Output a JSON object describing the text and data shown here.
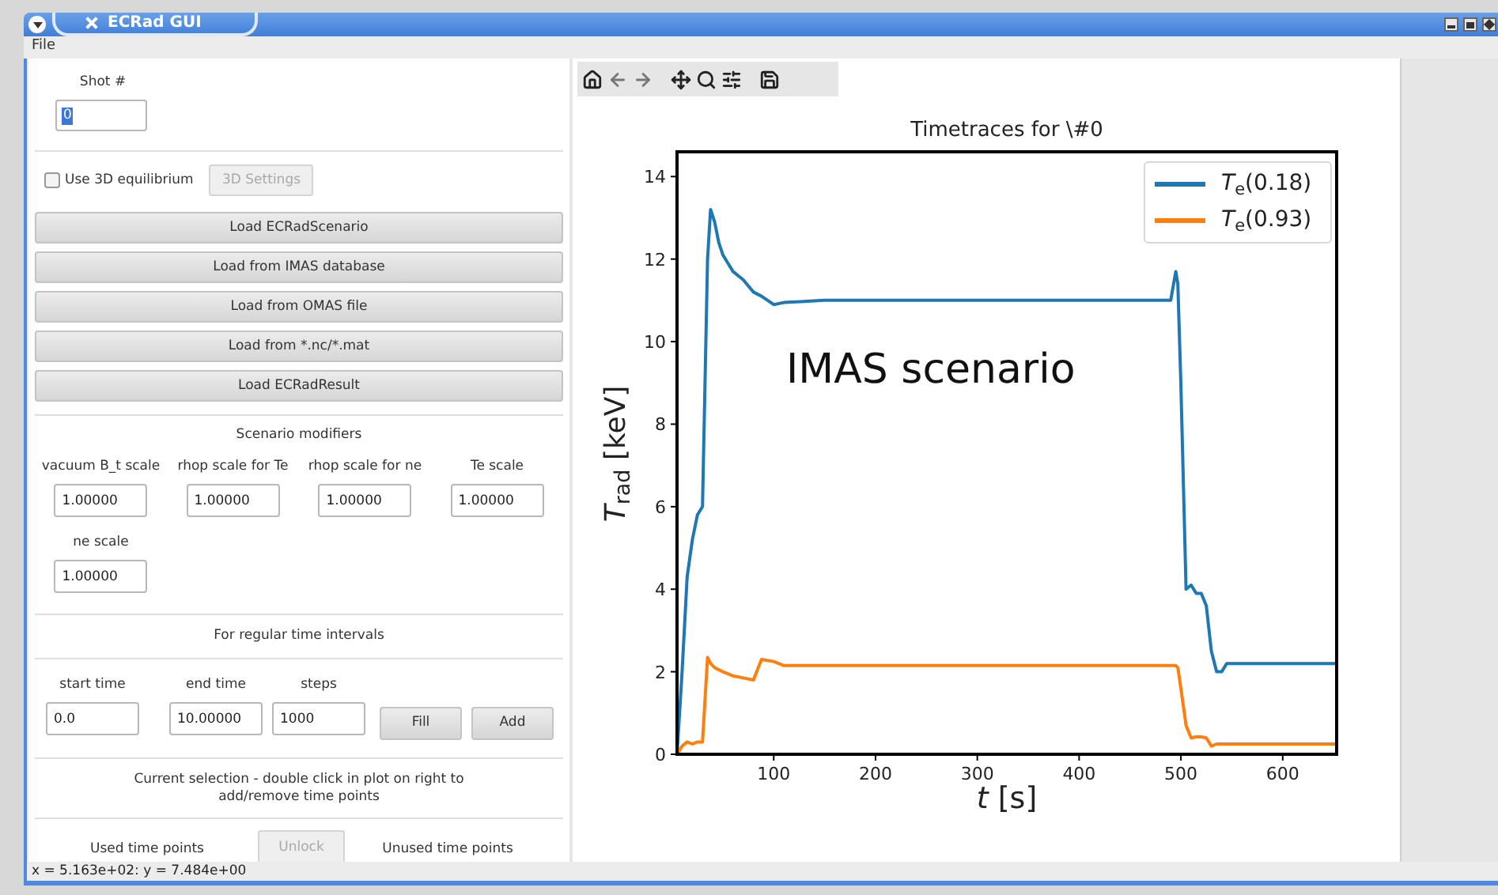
{
  "window": {
    "title": "ECRad GUI"
  },
  "menu": [
    "File"
  ],
  "left_panel": {
    "shot": {
      "label": "Shot #",
      "value": "0"
    },
    "use_3d": {
      "label": "Use 3D equilibrium",
      "checked": false
    },
    "settings_button": {
      "label": "3D Settings",
      "disabled": true
    },
    "load_buttons": [
      "Load ECRadScenario",
      "Load from IMAS database",
      "Load from OMAS file",
      "Load from *.nc/*.mat",
      "Load ECRadResult"
    ],
    "scenario_modifiers": {
      "title": "Scenario modifiers",
      "fields": [
        {
          "label": "vacuum B_t scale",
          "value": "1.00000"
        },
        {
          "label": "rhop scale for Te",
          "value": "1.00000"
        },
        {
          "label": "rhop scale for ne",
          "value": "1.00000"
        },
        {
          "label": "Te scale",
          "value": "1.00000"
        },
        {
          "label": "ne scale",
          "value": "1.00000"
        }
      ]
    },
    "time_intervals": {
      "title": "For regular time intervals",
      "fields": [
        {
          "label": "start time",
          "value": "0.0"
        },
        {
          "label": "end time",
          "value": "10.00000"
        },
        {
          "label": "steps",
          "value": "1000"
        }
      ],
      "buttons": [
        "Fill",
        "Add"
      ]
    },
    "selection_note": "Current selection - double click in plot on right to add/remove time points",
    "used_label": "Used time points",
    "unlock_button": {
      "label": "Unlock",
      "disabled": true
    },
    "unused_label": "Unused time points"
  },
  "plot": {
    "chart_data": {
      "type": "line",
      "title": "Timetraces for \\#0",
      "xlabel": "*t* [s]",
      "ylabel": "*T*$_{rad}$  [keV]",
      "x": [
        5,
        10,
        15,
        20,
        25,
        30,
        35,
        38,
        42,
        46,
        50,
        55,
        60,
        70,
        80,
        88,
        100,
        110,
        150,
        200,
        300,
        400,
        490,
        495,
        497,
        500,
        505,
        510,
        515,
        520,
        525,
        530,
        535,
        540,
        545,
        550,
        560,
        600,
        653
      ],
      "series": [
        {
          "name": "*T*$_{e}$(0.18)",
          "color": "#1f77b4",
          "values": [
            0,
            2,
            4.3,
            5.2,
            5.8,
            6,
            12,
            13.2,
            12.9,
            12.4,
            12.1,
            11.9,
            11.7,
            11.5,
            11.2,
            11.1,
            10.9,
            10.95,
            11,
            11,
            11,
            11,
            11,
            11.7,
            11.4,
            9,
            4,
            4.1,
            3.9,
            3.9,
            3.6,
            2.5,
            2,
            2,
            2.2,
            2.2,
            2.2,
            2.2,
            2.2
          ]
        },
        {
          "name": "*T*$_{e}$(0.93)",
          "color": "#ff7f0e",
          "values": [
            0,
            0.2,
            0.3,
            0.25,
            0.3,
            0.3,
            2.35,
            2.2,
            2.1,
            2.05,
            2,
            1.95,
            1.9,
            1.85,
            1.8,
            2.3,
            2.25,
            2.15,
            2.15,
            2.15,
            2.15,
            2.15,
            2.15,
            2.15,
            2.1,
            1.6,
            0.7,
            0.4,
            0.42,
            0.42,
            0.4,
            0.2,
            0.25,
            0.25,
            0.25,
            0.25,
            0.25,
            0.25,
            0.25
          ]
        }
      ],
      "xlim": [
        5,
        653
      ],
      "ylim": [
        0,
        14.6
      ],
      "xticks": [
        100,
        200,
        300,
        400,
        500,
        600
      ],
      "yticks": [
        0,
        2,
        4,
        6,
        8,
        10,
        12,
        14
      ],
      "legend": true,
      "annotations": [
        "IMAS scenario"
      ]
    }
  },
  "status_bar": "x = 5.163e+02: y = 7.484e+00"
}
